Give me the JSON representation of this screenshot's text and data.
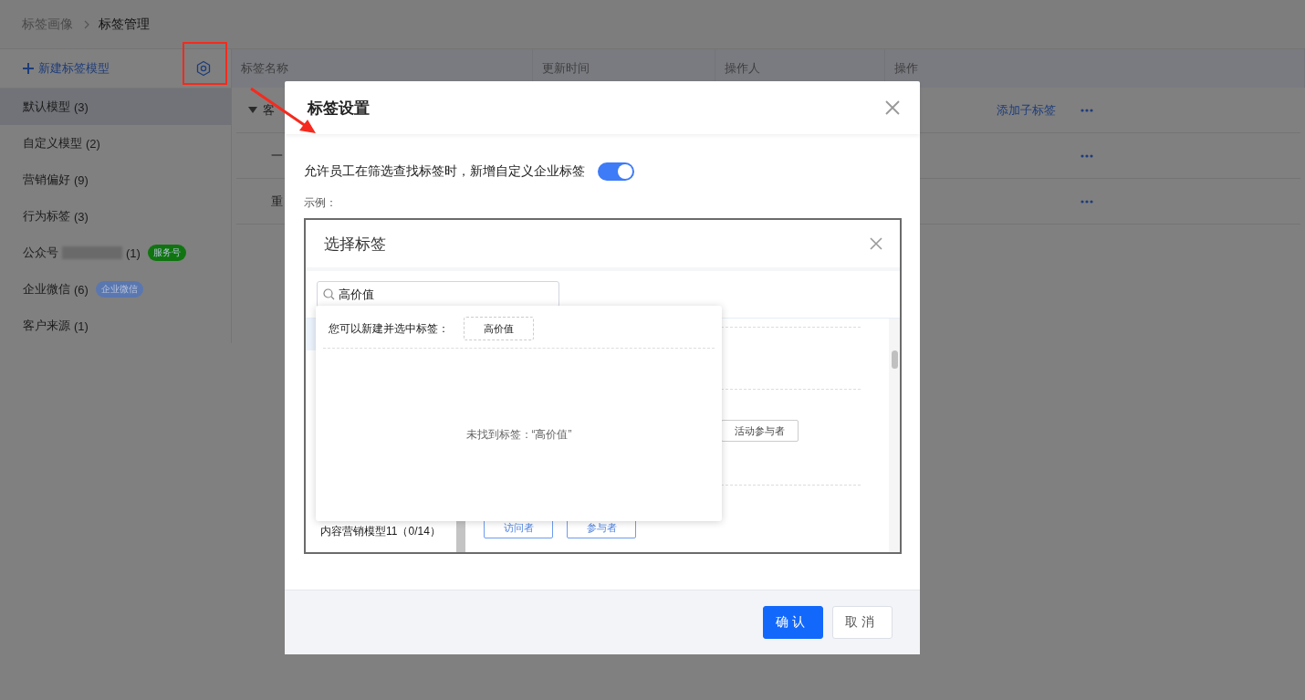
{
  "breadcrumb": [
    {
      "label": "标签画像",
      "current": false
    },
    {
      "label": "标签管理",
      "current": true
    }
  ],
  "sidebar": {
    "new_button": "新建标签模型",
    "items": [
      {
        "label": "默认模型",
        "count": "(3)",
        "selected": true
      },
      {
        "label": "自定义模型",
        "count": "(2)",
        "selected": false
      },
      {
        "label": "营销偏好",
        "count": "(9)",
        "selected": false
      },
      {
        "label": "行为标签",
        "count": "(3)",
        "selected": false
      },
      {
        "label": "公众号",
        "count": "(1)",
        "selected": false,
        "redacted": true,
        "badge": {
          "text": "服务号",
          "color": "#107510"
        }
      },
      {
        "label": "企业微信",
        "count": "(6)",
        "selected": false,
        "badge": {
          "text": "企业微信",
          "color": "#5a77b0"
        }
      },
      {
        "label": "客户来源",
        "count": "(1)",
        "selected": false
      }
    ]
  },
  "table": {
    "columns": [
      "标签名称",
      "更新时间",
      "操作人",
      "操作"
    ],
    "rows": [
      {
        "name": "客",
        "kind": "parent",
        "expanded": true,
        "actions": [
          "添加子标签"
        ]
      },
      {
        "name": "一",
        "kind": "child",
        "actions": []
      },
      {
        "name": "重",
        "kind": "child",
        "actions": []
      }
    ]
  },
  "dialog": {
    "title": "标签设置",
    "setting": {
      "label": "允许员工在筛选查找标签时，新增自定义企业标签",
      "on": true
    },
    "example_label": "示例：",
    "example": {
      "title": "选择标签",
      "search_value": "高价值",
      "create_hint": "您可以新建并选中标签：",
      "create_tag": "高价值",
      "empty_text": "未找到标签：“高价值”",
      "group_item": "内容营销模型11（0/14）",
      "sections": [
        {
          "tags": [
            {
              "label": "活动参与者",
              "selected": false
            }
          ]
        },
        {
          "tags": [
            {
              "label": "访问者",
              "selected": true
            },
            {
              "label": "参与者",
              "selected": true
            }
          ]
        }
      ]
    },
    "buttons": [
      {
        "label": "确认",
        "kind": "primary"
      },
      {
        "label": "取消",
        "kind": "default"
      }
    ]
  }
}
